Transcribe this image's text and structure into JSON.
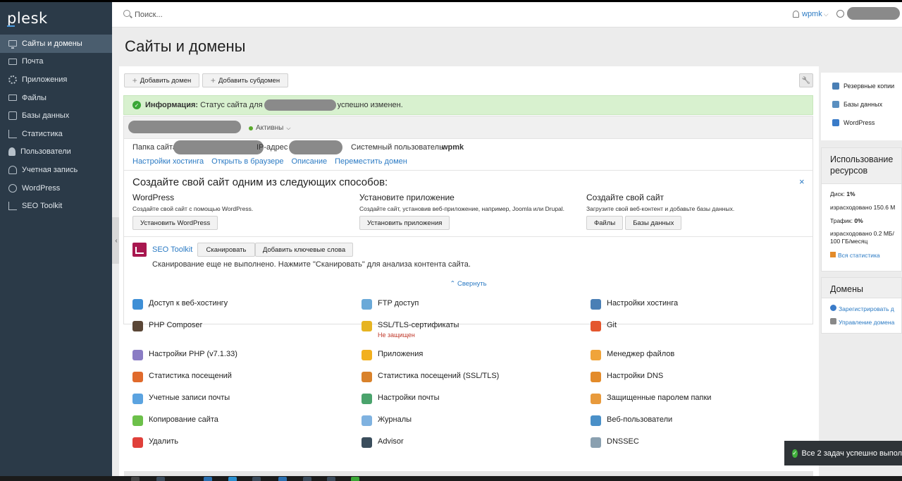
{
  "brand": {
    "logo": "plesk"
  },
  "sidebar": {
    "items": [
      {
        "label": "Сайты и домены",
        "icon": "monitor-icon",
        "active": true
      },
      {
        "label": "Почта",
        "icon": "mail-icon"
      },
      {
        "label": "Приложения",
        "icon": "gear-icon"
      },
      {
        "label": "Файлы",
        "icon": "folder-icon"
      },
      {
        "label": "Базы данных",
        "icon": "database-icon"
      },
      {
        "label": "Статистика",
        "icon": "stats-icon"
      },
      {
        "label": "Пользователи",
        "icon": "user-icon"
      },
      {
        "label": "Учетная запись",
        "icon": "account-icon"
      },
      {
        "label": "WordPress",
        "icon": "wordpress-icon"
      },
      {
        "label": "SEO Toolkit",
        "icon": "seo-icon"
      }
    ],
    "collapse_glyph": "‹"
  },
  "header": {
    "search_placeholder": "Поиск...",
    "user_name": "wpmk",
    "user_chevron": "⌵"
  },
  "page": {
    "title": "Сайты и домены"
  },
  "toolbar": {
    "add_domain": "Добавить домен",
    "add_subdomain": "Добавить субдомен",
    "plus_glyph": "+",
    "wrench_glyph": "🔧"
  },
  "info": {
    "label": "Информация:",
    "text_before": "Статус сайта для",
    "text_after": "успешно изменен."
  },
  "domain": {
    "status": "Активны",
    "status_chevron": "⌵",
    "folder_label": "Папка сайта",
    "ip_label": "IP-адрес",
    "sysuser_label": "Системный пользователь:",
    "sysuser_value": "wpmk",
    "links": [
      "Настройки хостинга",
      "Открыть в браузере",
      "Описание",
      "Переместить домен"
    ]
  },
  "create": {
    "title": "Создайте свой сайт одним из следующих способов:",
    "close": "×",
    "columns": [
      {
        "heading": "WordPress",
        "desc": "Создайте свой сайт с помощью WordPress.",
        "buttons": [
          "Установить WordPress"
        ]
      },
      {
        "heading": "Установите приложение",
        "desc": "Создайте сайт, установив веб-приложение, например, Joomla или Drupal.",
        "buttons": [
          "Установить приложения"
        ]
      },
      {
        "heading": "Создайте свой сайт",
        "desc": "Загрузите свой веб-контент и добавьте базы данных.",
        "buttons": [
          "Файлы",
          "Базы данных"
        ]
      }
    ]
  },
  "seo": {
    "name": "SEO Toolkit",
    "scan_button": "Сканировать",
    "keywords_button": "Добавить ключевые слова",
    "desc": "Сканирование еще не выполнено. Нажмите \"Сканировать\" для анализа контента сайта."
  },
  "collapse_link": "⌃ Свернуть",
  "tools": [
    {
      "label": "Доступ к веб-хостингу",
      "color": "#3e8fd6"
    },
    {
      "label": "FTP доступ",
      "color": "#6aa9d8"
    },
    {
      "label": "Настройки хостинга",
      "color": "#4a7fb5"
    },
    {
      "label": "PHP Composer",
      "color": "#5a4636"
    },
    {
      "label": "SSL/TLS-сертификаты",
      "color": "#e6b422",
      "sub": "Не защищен"
    },
    {
      "label": "Git",
      "color": "#e4572e"
    },
    {
      "label": "Настройки PHP (v7.1.33)",
      "color": "#8a7cc4"
    },
    {
      "label": "Приложения",
      "color": "#f2b01e"
    },
    {
      "label": "Менеджер файлов",
      "color": "#f0a43a"
    },
    {
      "label": "Статистика посещений",
      "color": "#e06a2c"
    },
    {
      "label": "Статистика посещений (SSL/TLS)",
      "color": "#d9822b"
    },
    {
      "label": "Настройки DNS",
      "color": "#e38b2a"
    },
    {
      "label": "Учетные записи почты",
      "color": "#5ba3e0"
    },
    {
      "label": "Настройки почты",
      "color": "#4aa36c"
    },
    {
      "label": "Защищенные паролем папки",
      "color": "#e89a3c"
    },
    {
      "label": "Копирование сайта",
      "color": "#6cc04a"
    },
    {
      "label": "Журналы",
      "color": "#7fb2e0"
    },
    {
      "label": "Веб-пользователи",
      "color": "#4a90c8"
    },
    {
      "label": "Удалить",
      "color": "#e0403a"
    },
    {
      "label": "Advisor",
      "color": "#3a4d5c"
    },
    {
      "label": "DNSSEC",
      "color": "#8aa0b0"
    }
  ],
  "right": {
    "quick_links": [
      "Резервные копии",
      "Базы данных",
      "WordPress"
    ],
    "resources": {
      "title": "Использование ресурсов",
      "disk_label": "Диск:",
      "disk_value": "1%",
      "disk_used": "израсходовано 150.6 М",
      "traffic_label": "Трафик:",
      "traffic_value": "0%",
      "traffic_used": "израсходовано 0.2 МБ/",
      "traffic_limit": "100 ГБ/месяц",
      "all_stats": "Вся статистика"
    },
    "domains": {
      "title": "Домены",
      "register": "Зарегистрировать д",
      "manage": "Управление домена"
    }
  },
  "toast": {
    "text": "Все 2 задач успешно выпол"
  }
}
